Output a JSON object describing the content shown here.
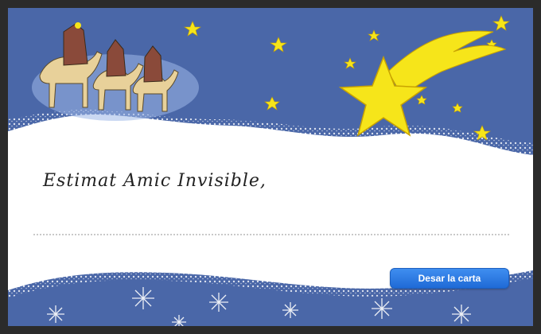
{
  "letter": {
    "greeting": "Estimat Amic Invisible,",
    "message_value": "",
    "save_label": "Desar la carta"
  },
  "colors": {
    "sky": "#4a67a8",
    "star": "#f6e51a",
    "snow": "#ffffff",
    "button": "#2a7ae2"
  },
  "icons": {
    "shooting_star": "shooting-star-icon",
    "three_kings": "three-kings-icon",
    "snowflakes": "snowflake-icon"
  }
}
